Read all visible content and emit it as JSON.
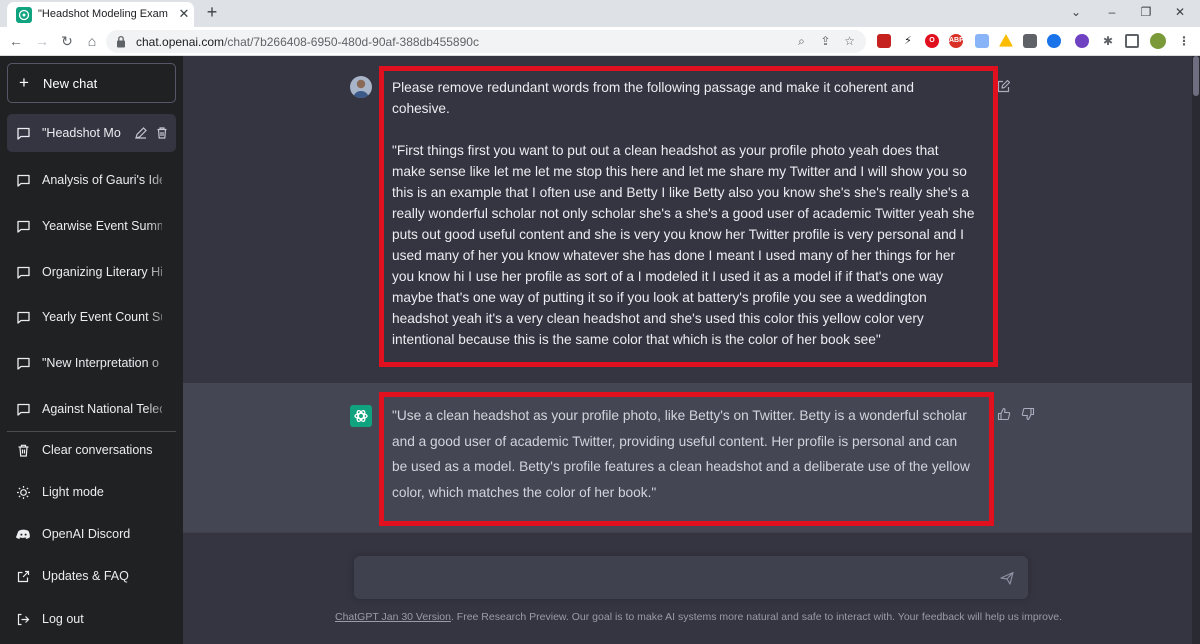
{
  "browser": {
    "tab_title": "\"Headshot Modeling Example\"",
    "tab_close": "✕",
    "new_tab": "+",
    "url_host": "chat.openai.com",
    "url_path": "/chat/7b266408-6950-480d-90af-388db455890c",
    "window_controls": [
      "⌄",
      "–",
      "❐",
      "✕"
    ],
    "ext_abp_label": "ABP"
  },
  "sidebar": {
    "new_chat": "New chat",
    "conversations": [
      "\"Headshot Mo",
      "Analysis of Gauri's Ide",
      "Yearwise Event Summ",
      "Organizing Literary Hi",
      "Yearly Event Count Su",
      "\"New Interpretation o",
      "Against National Telec"
    ],
    "actions": {
      "clear": "Clear conversations",
      "light_mode": "Light mode",
      "discord": "OpenAI Discord",
      "updates": "Updates & FAQ",
      "logout": "Log out"
    }
  },
  "chat": {
    "user_message": {
      "intro_line1": "Please remove redundant words from the following passage and make it coherent and",
      "intro_line2": "cohesive.",
      "passage_lines": [
        "\"First things first you want to put out a clean headshot as your profile photo yeah does that",
        "make sense like let me let me stop this here and let me share my Twitter and I will show you so",
        "this is an example that I often use and Betty I like Betty also you know she's she's really she's a",
        "really wonderful scholar not only scholar she's a she's a good user of academic Twitter yeah she",
        "puts out good useful content and she is very you know her Twitter profile is very personal and I",
        "used many of her you know whatever she has done I meant I used many of her things for her",
        "you know hi I use her profile as sort of a I modeled it I used it as a model if if that's one way",
        "maybe that's one way of putting it so if you look at battery's profile you see a weddington",
        "headshot yeah it's a very clean headshot and she's used this color this yellow color very",
        "intentional because this is the same color that which is the color of her book see\""
      ]
    },
    "ai_message_lines": [
      "\"Use a clean headshot as your profile photo, like Betty's on Twitter. Betty is a wonderful scholar",
      "and a good user of academic Twitter, providing useful content. Her profile is personal and can",
      "be used as a model. Betty's profile features a clean headshot and a deliberate use of the yellow",
      "color, which matches the color of her book.\""
    ],
    "input_placeholder": "",
    "footer_link": "ChatGPT Jan 30 Version",
    "footer_text": ". Free Research Preview. Our goal is to make AI systems more natural and safe to interact with. Your feedback will help us improve."
  },
  "colors": {
    "sidebar_bg": "#202123",
    "main_bg": "#343541",
    "ai_bg": "#444654",
    "accent": "#10a37f",
    "highlight": "#e0101e"
  }
}
